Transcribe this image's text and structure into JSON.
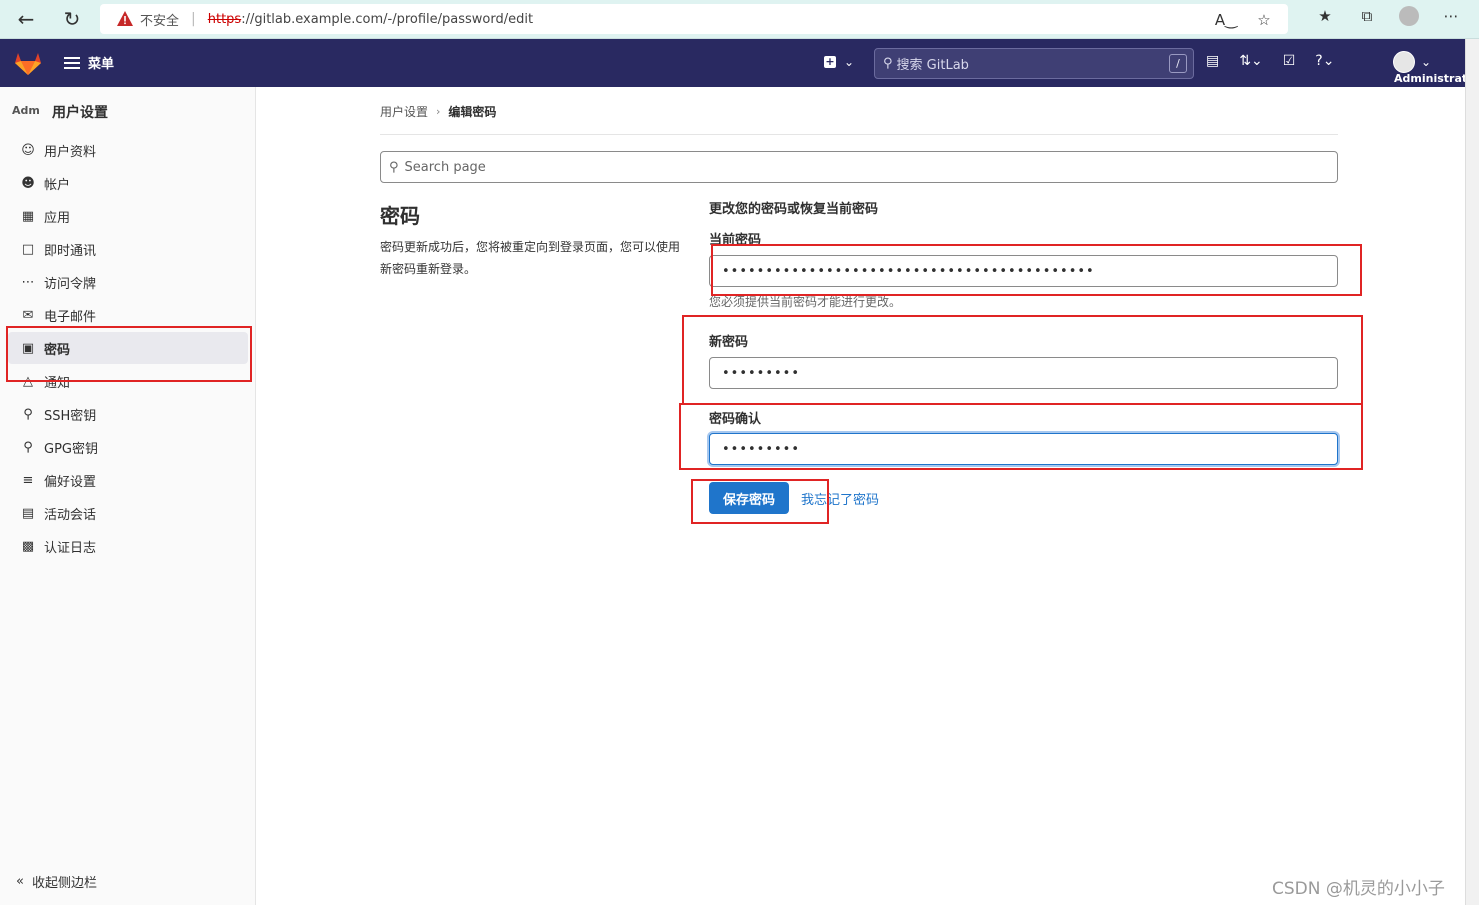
{
  "browser": {
    "insecure_label": "不安全",
    "url_scheme": "https",
    "url_rest": "://gitlab.example.com/-/profile/password/edit"
  },
  "header": {
    "menu_label": "菜单",
    "search_placeholder": "搜索 GitLab",
    "search_shortcut": "/",
    "user_name": "Administrator"
  },
  "sidebar": {
    "avatar_alt": "Adm",
    "title": "用户设置",
    "items": [
      {
        "label": "用户资料",
        "icon": "user-icon"
      },
      {
        "label": "帐户",
        "icon": "account-icon"
      },
      {
        "label": "应用",
        "icon": "applications-icon"
      },
      {
        "label": "即时通讯",
        "icon": "chat-icon"
      },
      {
        "label": "访问令牌",
        "icon": "token-icon"
      },
      {
        "label": "电子邮件",
        "icon": "mail-icon"
      },
      {
        "label": "密码",
        "icon": "lock-icon",
        "active": true
      },
      {
        "label": "通知",
        "icon": "notifications-icon"
      },
      {
        "label": "SSH密钥",
        "icon": "key-icon"
      },
      {
        "label": "GPG密钥",
        "icon": "key-icon"
      },
      {
        "label": "偏好设置",
        "icon": "preferences-icon"
      },
      {
        "label": "活动会话",
        "icon": "sessions-icon"
      },
      {
        "label": "认证日志",
        "icon": "log-icon"
      }
    ],
    "collapse_label": "收起侧边栏"
  },
  "breadcrumb": {
    "parent": "用户设置",
    "current": "编辑密码"
  },
  "search_page": {
    "placeholder": "Search page"
  },
  "section": {
    "title": "密码",
    "description": "密码更新成功后，您将被重定向到登录页面，您可以使用新密码重新登录。"
  },
  "form": {
    "heading": "更改您的密码或恢复当前密码",
    "current_label": "当前密码",
    "current_value": "•••••••••••••••••••••••••••••••••••••••••••",
    "current_help": "您必须提供当前密码才能进行更改。",
    "new_label": "新密码",
    "new_value": "•••••••••",
    "confirm_label": "密码确认",
    "confirm_value": "•••••••••",
    "save_label": "保存密码",
    "forgot_label": "我忘记了密码"
  },
  "watermark": "CSDN @机灵的小小子",
  "colors": {
    "header_bg": "#292961",
    "primary": "#1f75cb",
    "annotation": "#e02424"
  }
}
